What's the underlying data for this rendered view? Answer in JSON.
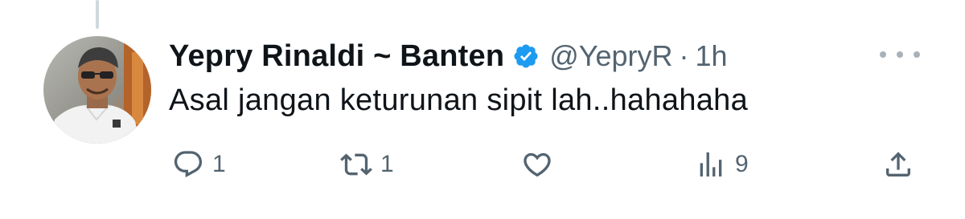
{
  "tweet": {
    "display_name": "Yepry Rinaldi ~ Banten",
    "handle": "@YepryR",
    "separator": "·",
    "time": "1h",
    "text": "Asal jangan keturunan sipit lah..hahahaha",
    "verified": true
  },
  "actions": {
    "reply_count": "1",
    "retweet_count": "1",
    "views_count": "9"
  },
  "icons": {
    "reply": "reply-icon",
    "retweet": "retweet-icon",
    "like": "heart-icon",
    "views": "views-icon",
    "share": "share-icon",
    "more": "more-icon",
    "verified": "verified-badge-icon"
  },
  "colors": {
    "text_primary": "#0f1419",
    "text_secondary": "#536471",
    "verified_blue": "#1d9bf0",
    "thread_line": "#cfd9de"
  }
}
